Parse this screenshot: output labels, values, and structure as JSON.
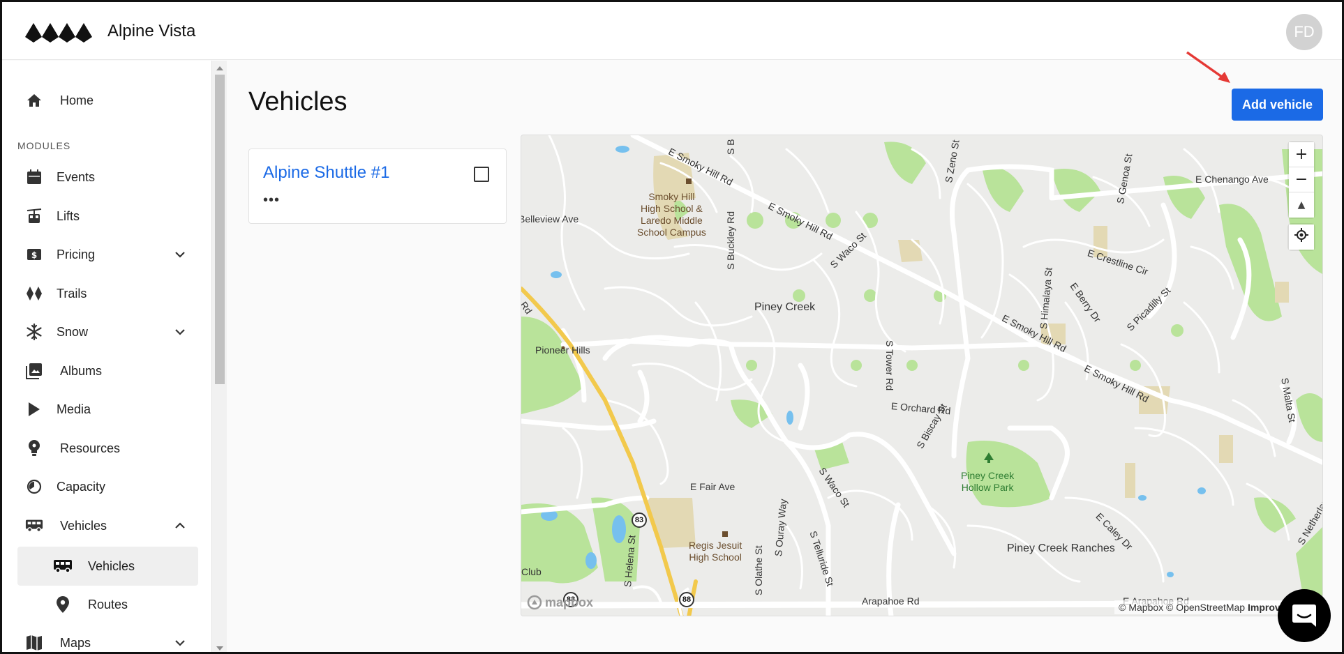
{
  "header": {
    "app_title": "Alpine Vista",
    "avatar_initials": "FD"
  },
  "sidebar": {
    "section_label": "MODULES",
    "items": [
      {
        "label": "Home",
        "icon": "home-icon"
      },
      {
        "label": "Events",
        "icon": "calendar-icon"
      },
      {
        "label": "Lifts",
        "icon": "gondola-icon"
      },
      {
        "label": "Pricing",
        "icon": "dollar-icon",
        "expanded": false
      },
      {
        "label": "Trails",
        "icon": "diamond-icon"
      },
      {
        "label": "Snow",
        "icon": "snowflake-icon",
        "expanded": false
      },
      {
        "label": "Albums",
        "icon": "photo-album-icon"
      },
      {
        "label": "Media",
        "icon": "play-icon"
      },
      {
        "label": "Resources",
        "icon": "lightbulb-icon"
      },
      {
        "label": "Capacity",
        "icon": "gauge-icon"
      },
      {
        "label": "Vehicles",
        "icon": "bus-icon",
        "expanded": true
      },
      {
        "label": "Maps",
        "icon": "map-icon",
        "expanded": false
      }
    ],
    "vehicles_sub": [
      {
        "label": "Vehicles",
        "icon": "bus-icon",
        "active": true
      },
      {
        "label": "Routes",
        "icon": "location-pin-icon",
        "active": false
      }
    ]
  },
  "main": {
    "title": "Vehicles",
    "add_button": "Add vehicle",
    "vehicles": [
      {
        "name": "Alpine Shuttle #1",
        "more": "•••"
      }
    ]
  },
  "map": {
    "labels": {
      "smoky_hill_rd_1": "E Smoky Hill Rd",
      "smoky_hill_rd_2": "E Smoky Hill Rd",
      "smoky_hill_rd_3": "E Smoky Hill Rd",
      "smoky_hill_rd_4": "E Smoky Hill Rd",
      "chenango": "E Chenango Ave",
      "belleview": "Belleview Ave",
      "smoky_school": "Smoky Hill\nHigh School &\nLaredo Middle\nSchool Campus",
      "s_buckley": "S Buckley Rd",
      "s_b": "S B",
      "s_zeno": "S Zeno St",
      "s_genoa": "S Genoa St",
      "s_waco_1": "S Waco St",
      "s_waco_2": "S Waco St",
      "crestline": "E Crestline Cir",
      "himalaya": "S Himalaya St",
      "berry": "E Berry Dr",
      "picadilly": "S Picadilly St",
      "piney_creek": "Piney Creek",
      "tower_rd": "S Tower Rd",
      "pioneer_hills": "Pioneer Hills",
      "rd_left": "Rd",
      "orchard": "E Orchard Rd",
      "biscay": "S Biscay St",
      "malta": "S Malta St",
      "piney_park": "Piney Creek\nHollow Park",
      "fair_ave": "E Fair Ave",
      "regis": "Regis Jesuit\nHigh School",
      "ouray": "S Ouray Way",
      "olathe": "S Olathe St",
      "telluride": "S Telluride St",
      "helena": "S Helena St",
      "caley": "E Caley Dr",
      "netherland": "S Netherland Way",
      "piney_ranches": "Piney Creek Ranches",
      "club": "Club",
      "arapahoe_1": "Arapahoe Rd",
      "arapahoe_2": "E Arapahoe Rd"
    },
    "shields": [
      "83",
      "88",
      "88"
    ],
    "zoom_in": "+",
    "zoom_out": "−",
    "compass": "▲",
    "logo": "mapbox",
    "attribution_a": "© Mapbox © OpenStreetMap ",
    "attribution_b": "Improve t"
  },
  "colors": {
    "accent": "#1b6ae6",
    "park": "#b5e08f",
    "school": "#e3d9b4",
    "highway": "#f2c94c",
    "water": "#76c0ee"
  }
}
